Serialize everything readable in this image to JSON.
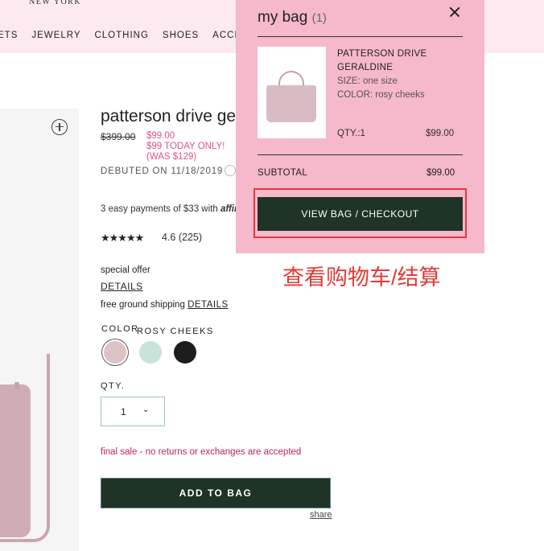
{
  "header": {
    "brand_subtitle": "NEW YORK",
    "nav": [
      "ETS",
      "JEWELRY",
      "CLOTHING",
      "SHOES",
      "ACCESS"
    ]
  },
  "product": {
    "title": "patterson drive ge",
    "old_price": "$399.00",
    "new_price": "$99.00",
    "promo_line1": "$99 TODAY ONLY!",
    "promo_line2": "(WAS $129)",
    "debuted": "DEBUTED ON 11/18/2019",
    "payments_text": "3 easy payments of $33 with ",
    "payments_brand": "affir",
    "stars_glyph": "★★★★★",
    "rating_value": 4.6,
    "rating_text": "4.6 (225)",
    "special_offer": "special offer",
    "details_link": "DETAILS",
    "shipping_text": "free ground shipping ",
    "shipping_link": "DETAILS",
    "color_label": "COLOR",
    "color_name": "ROSY CHEEKS",
    "swatches": [
      {
        "name": "rosy cheeks",
        "color": "#dcc3c6",
        "selected": true
      },
      {
        "name": "mint",
        "color": "#c9e3dc",
        "selected": false
      },
      {
        "name": "black",
        "color": "#1d1d1d",
        "selected": false
      }
    ],
    "qty_label": "QTY.",
    "qty_value": "1",
    "qty_chevron": "⌄",
    "final_sale_label": "final sale",
    "final_sale_note": " - no returns or exchanges are accepted",
    "add_to_bag": "ADD TO BAG",
    "share": "share"
  },
  "bag": {
    "title": "my bag",
    "count": "(1)",
    "item": {
      "name": "PATTERSON DRIVE GERALDINE",
      "size": "SIZE: one size",
      "color": "COLOR: rosy cheeks",
      "qty": "QTY.:1",
      "price": "$99.00"
    },
    "subtotal_label": "SUBTOTAL",
    "subtotal_value": "$99.00",
    "checkout_button": "VIEW BAG / CHECKOUT"
  },
  "annotation": "查看购物车/结算",
  "colors": {
    "dark_green": "#1f3426",
    "bag_pink": "#f6b8cb",
    "sale_pink": "#e0527c",
    "annotation_red": "#e53935"
  }
}
